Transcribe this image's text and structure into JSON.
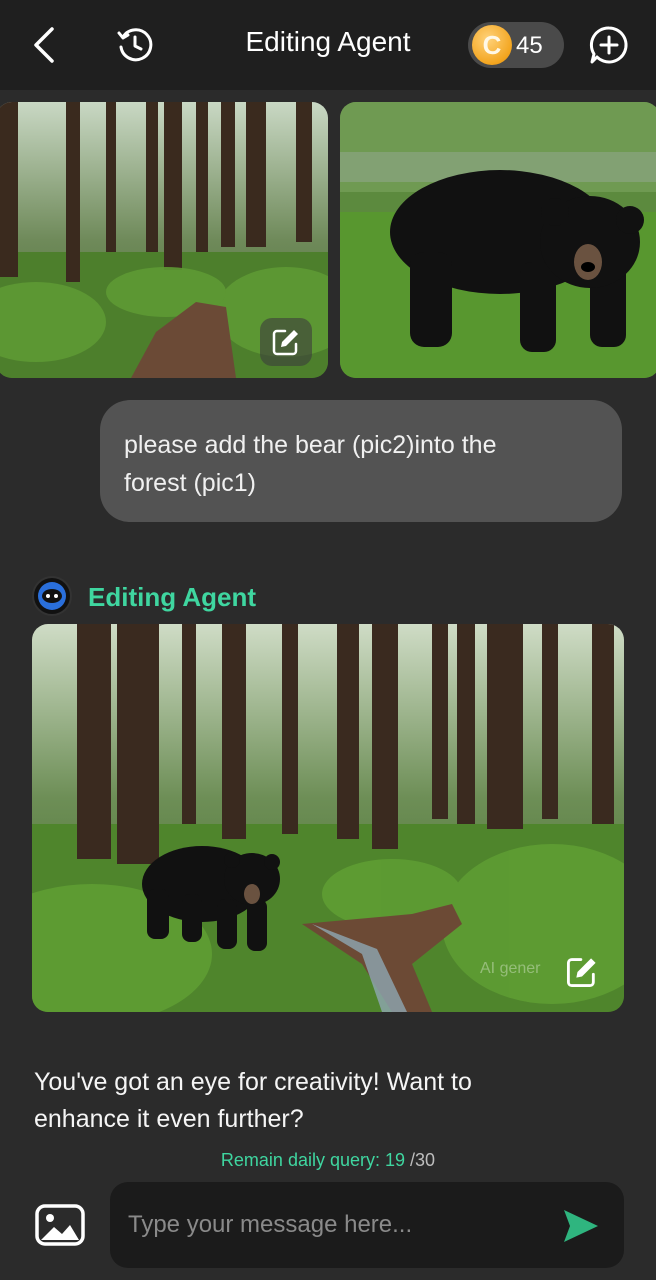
{
  "header": {
    "title": "Editing Agent",
    "coin_count": "45",
    "coin_symbol": "C",
    "icons": [
      "chevron-left-icon",
      "history-icon",
      "new-chat-icon"
    ]
  },
  "attachments": [
    {
      "name": "forest-image"
    },
    {
      "name": "bear-image"
    }
  ],
  "user_message": {
    "line1": "please add the bear (pic2)into the",
    "line2": "forest (pic1)"
  },
  "agent": {
    "name": "Editing Agent",
    "watermark": "AI gener",
    "reply_line1": "You've got an eye for creativity! Want to",
    "reply_line2": "enhance it even further?"
  },
  "quota": {
    "label": "Remain daily query: ",
    "remaining": "19",
    "total": " /30"
  },
  "composer": {
    "placeholder": "Type your message here..."
  },
  "colors": {
    "accent": "#3fd6a0",
    "background": "#2b2b2b",
    "header": "#1f1f1f",
    "bubble": "#535353"
  }
}
